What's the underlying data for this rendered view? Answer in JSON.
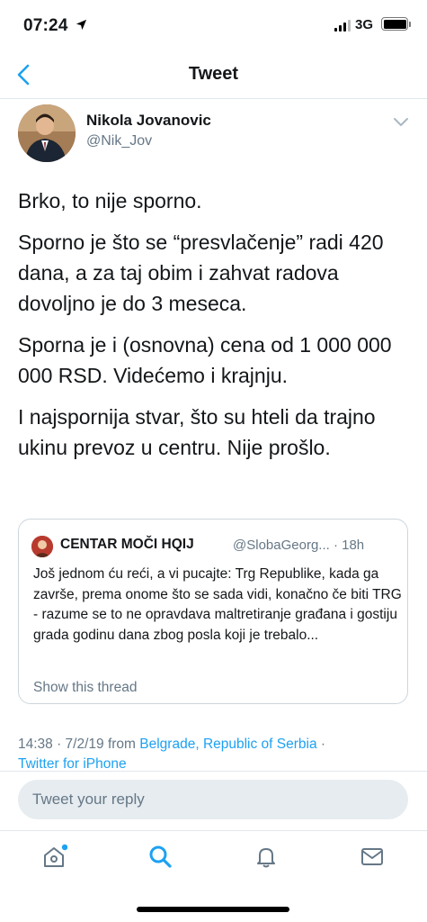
{
  "status_bar": {
    "time": "07:24",
    "network": "3G"
  },
  "nav": {
    "title": "Tweet"
  },
  "tweet": {
    "author_name": "Nikola Jovanovic",
    "author_handle": "@Nik_Jov",
    "paragraphs": [
      "Brko, to nije sporno.",
      "Sporno je što se “presvlačenje” radi 420 dana, a za taj obim i zahvat radova dovoljno je do 3 meseca.",
      "Sporna je i (osnovna) cena od 1 000 000 000 RSD. Videćemo i krajnju.",
      "I najspornija stvar, što su hteli da trajno ukinu prevoz u centru. Nije prošlo."
    ],
    "quote": {
      "name": "CENTAR MOČI HQIJ",
      "handle_time": "@SlobaGeorg... · 18h",
      "text": "Još jednom ću reći, a vi pucajte: Trg Republike, kada ga završe, prema onome što se sada vidi, konačno če biti TRG - razume se to ne opravdava maltretiranje građana i gostiju grada godinu dana zbog posla koji je trebalo...",
      "show_thread": "Show this thread"
    },
    "meta": {
      "datetime": "14:38 · 7/2/19 from ",
      "location": "Belgrade, Republic of Serbia",
      "separator": " ·",
      "client": "Twitter for iPhone"
    }
  },
  "reply": {
    "placeholder": "Tweet your reply"
  },
  "tabs": [
    {
      "name": "home",
      "icon": "home-icon"
    },
    {
      "name": "search",
      "icon": "search-icon"
    },
    {
      "name": "notifications",
      "icon": "bell-icon"
    },
    {
      "name": "messages",
      "icon": "mail-icon"
    }
  ],
  "colors": {
    "accent": "#1da1f2",
    "secondary_text": "#657786",
    "primary_text": "#14171a"
  }
}
